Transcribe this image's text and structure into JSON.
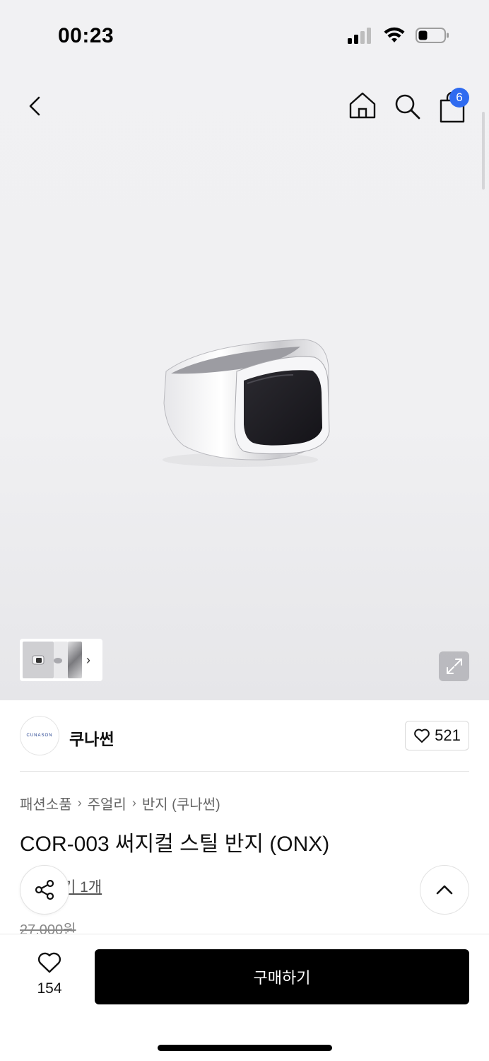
{
  "status": {
    "time": "00:23"
  },
  "nav": {
    "cart_badge": "6"
  },
  "brand": {
    "logo_text": "CUNASON",
    "name": "쿠나썬",
    "like_count": "521"
  },
  "breadcrumb": {
    "items": [
      "패션소품",
      "주얼리",
      "반지 (쿠나썬)"
    ]
  },
  "product": {
    "title": "COR-003 써지컬 스틸 반지 (ONX)",
    "review_link": "기 1개",
    "original_price": "27,000원"
  },
  "bottom": {
    "wish_count": "154",
    "buy_label": "구매하기"
  },
  "colors": {
    "badge": "#2f6bf0",
    "buy_button": "#000000"
  }
}
